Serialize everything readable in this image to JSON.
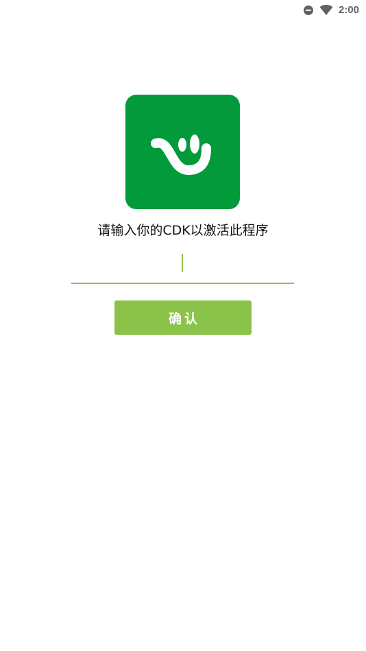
{
  "status_bar": {
    "time": "2:00",
    "icons": [
      "do-not-disturb-icon",
      "wifi-icon"
    ],
    "icon_color": "#5f6368"
  },
  "app": {
    "icon": "smiley-logo-icon",
    "brand_color": "#029a3b"
  },
  "activation": {
    "prompt": "请输入你的CDK以激活此程序",
    "cdk_value": "",
    "accent_color": "#8bc34a",
    "confirm_label": "确认"
  }
}
